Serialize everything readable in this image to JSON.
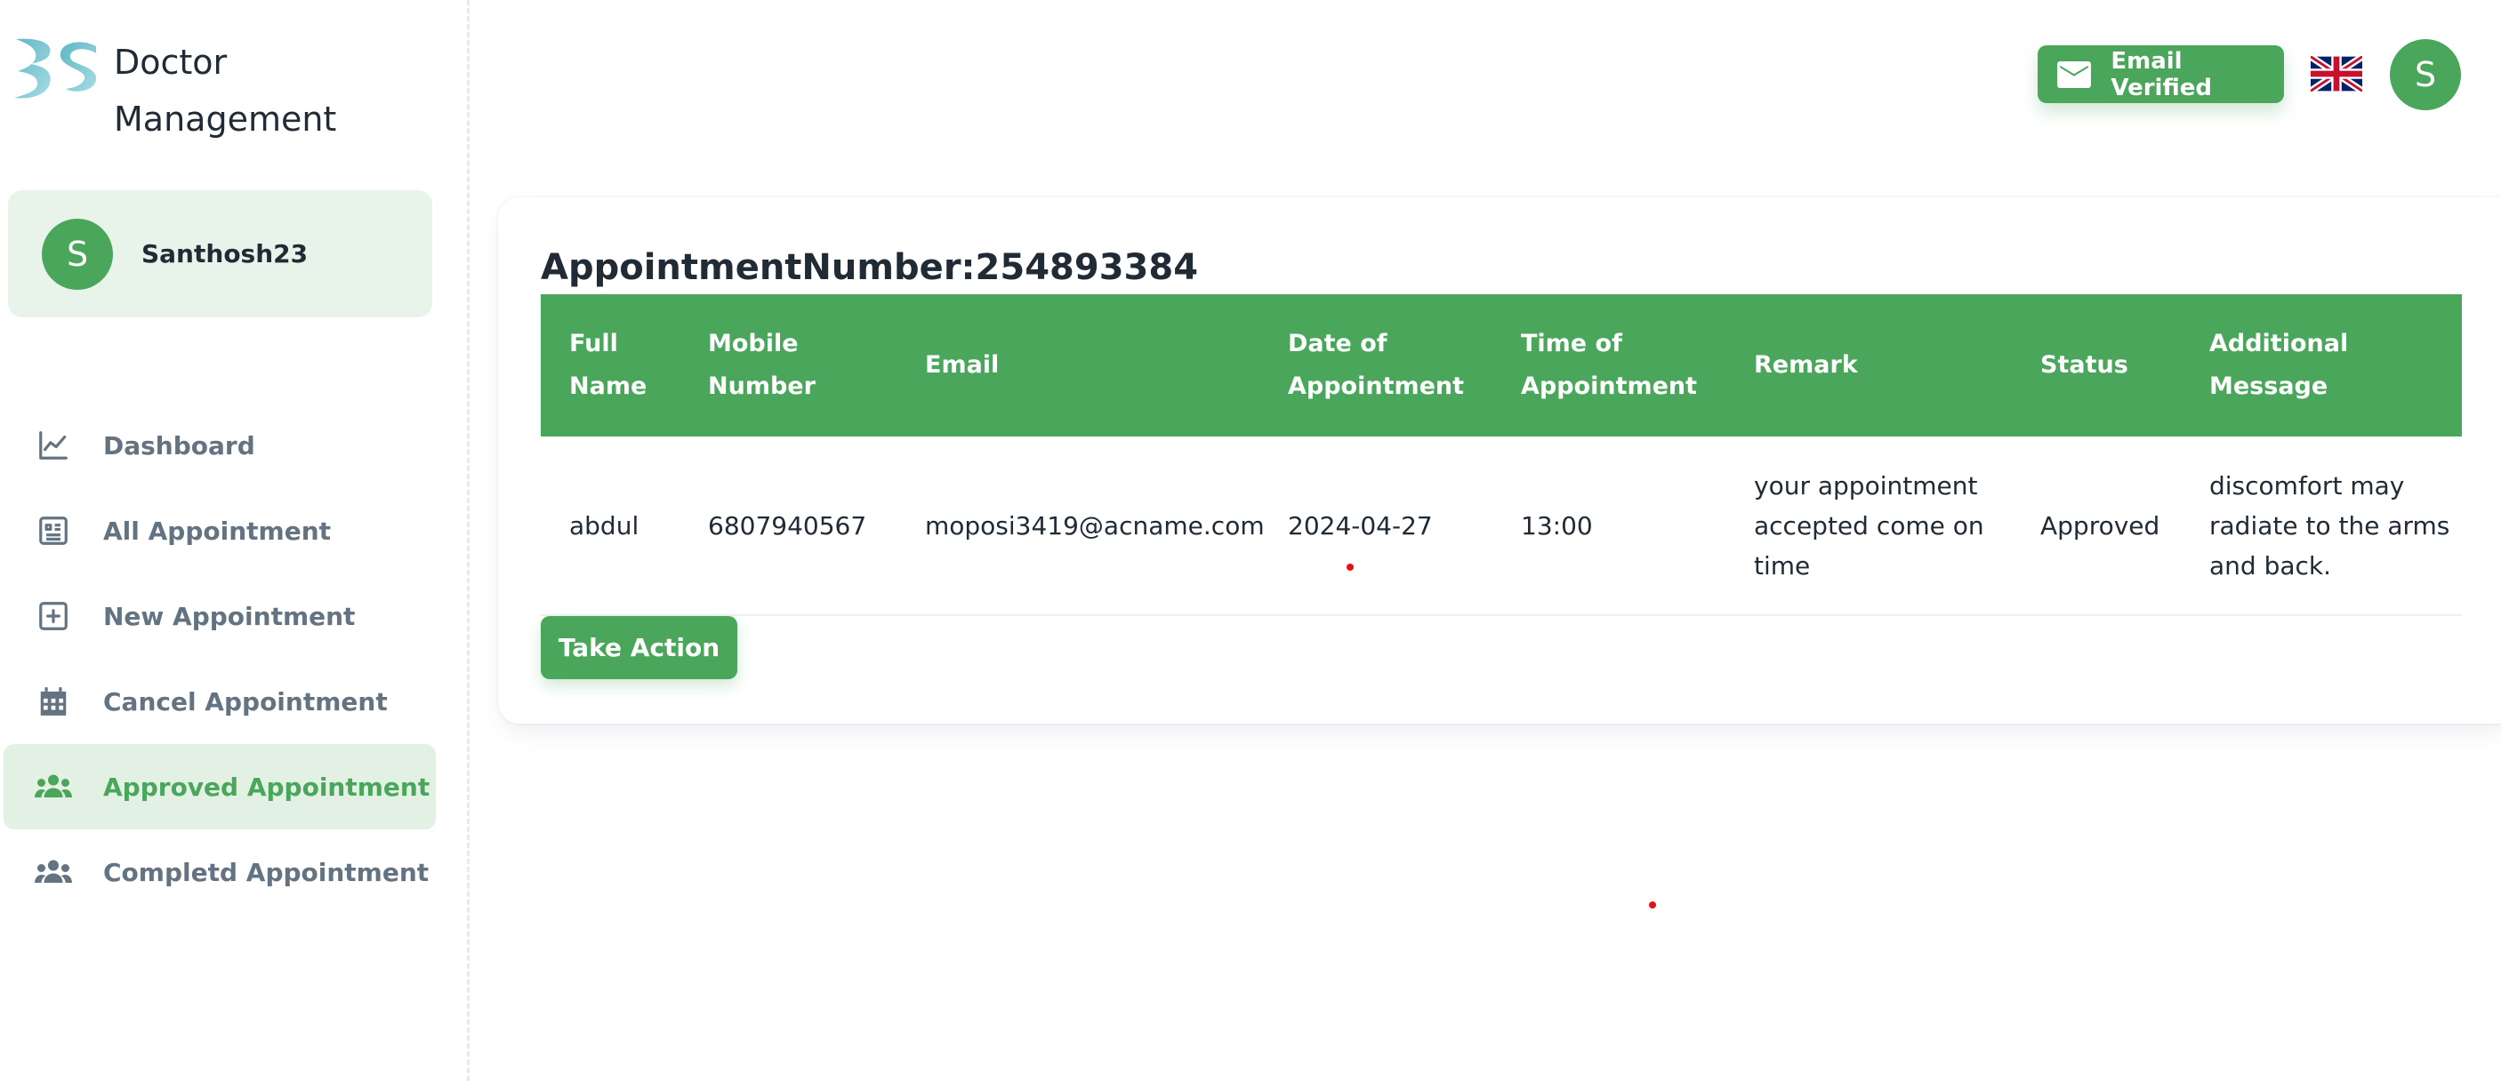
{
  "brand": {
    "line1": "Doctor",
    "line2": "Management"
  },
  "user": {
    "initial": "S",
    "name": "Santhosh23"
  },
  "nav": [
    {
      "label": "Dashboard",
      "icon": "chart-line-icon"
    },
    {
      "label": "All Appointment",
      "icon": "list-icon"
    },
    {
      "label": "New Appointment",
      "icon": "plus-square-icon"
    },
    {
      "label": "Cancel Appointment",
      "icon": "calendar-icon"
    },
    {
      "label": "Approved Appointment",
      "icon": "users-icon",
      "active": true
    },
    {
      "label": "Completd Appointment",
      "icon": "users-icon"
    }
  ],
  "header": {
    "email_status": "Email Verified",
    "avatar_initial": "S",
    "language": "uk-flag-icon"
  },
  "appointment": {
    "title": "AppointmentNumber:254893384",
    "columns": {
      "full_name": [
        "Full",
        "Name"
      ],
      "mobile": [
        "Mobile",
        "Number"
      ],
      "email": "Email",
      "date": [
        "Date of",
        "Appointment"
      ],
      "time": [
        "Time of",
        "Appointment"
      ],
      "remark": "Remark",
      "status": "Status",
      "message": [
        "Additional",
        "Message"
      ]
    },
    "row": {
      "full_name": "abdul",
      "mobile": "6807940567",
      "email": "moposi3419@acname.com",
      "date": "2024-04-27",
      "time": "13:00",
      "remark": [
        "your appointment",
        "accepted come on",
        "time"
      ],
      "status": "Approved",
      "message": [
        "discomfort may",
        "radiate to the arms",
        "and back."
      ]
    },
    "action_label": "Take Action"
  },
  "colors": {
    "accent": "#4aa65b",
    "accent_light": "#e8f4ea",
    "muted_text": "#637381",
    "dot": "#e3121b"
  }
}
